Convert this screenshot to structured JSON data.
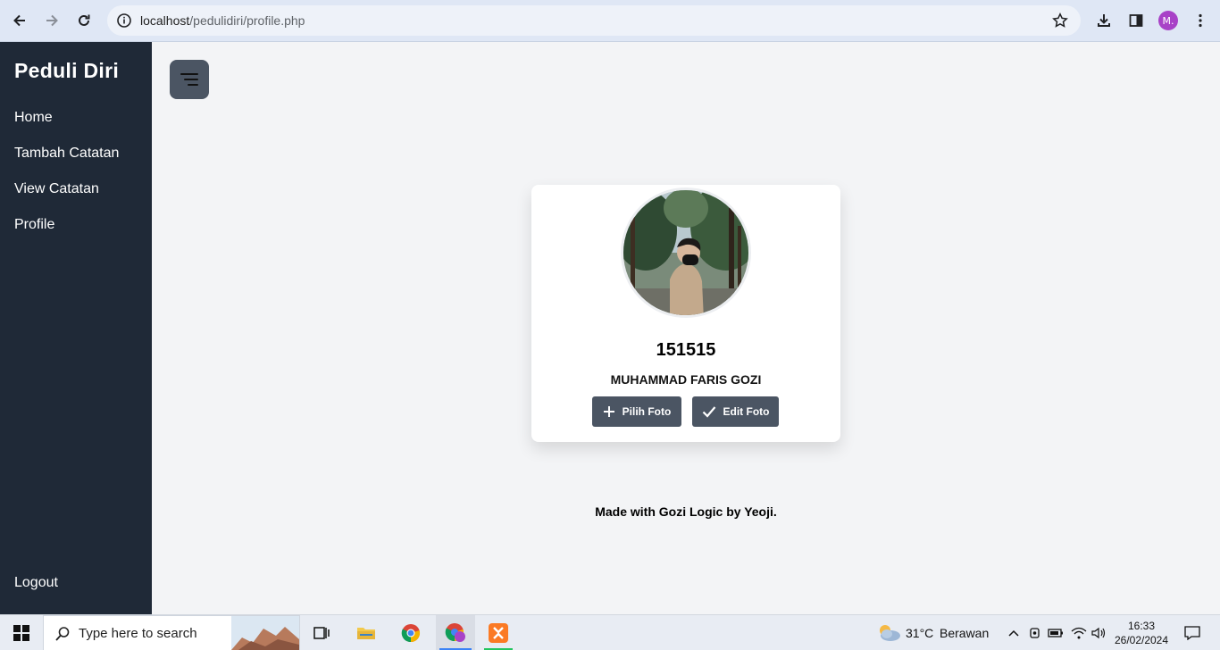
{
  "browser": {
    "url_host": "localhost",
    "url_path": "/pedulidiri/profile.php",
    "profile_initial": "M."
  },
  "sidebar": {
    "brand": "Peduli Diri",
    "items": [
      {
        "label": "Home"
      },
      {
        "label": "Tambah Catatan"
      },
      {
        "label": "View Catatan"
      },
      {
        "label": "Profile"
      }
    ],
    "logout_label": "Logout"
  },
  "profile": {
    "user_id": "151515",
    "name": "MUHAMMAD FARIS GOZI",
    "pick_photo_label": "Pilih Foto",
    "edit_photo_label": "Edit Foto"
  },
  "footer": {
    "text": "Made with Gozi Logic by Yeoji."
  },
  "taskbar": {
    "search_placeholder": "Type here to search",
    "weather_temp": "31°C",
    "weather_desc": "Berawan",
    "time": "16:33",
    "date": "26/02/2024"
  },
  "colors": {
    "sidebar_bg": "#1f2937",
    "button_bg": "#4b5563",
    "page_bg": "#f3f4f6"
  }
}
